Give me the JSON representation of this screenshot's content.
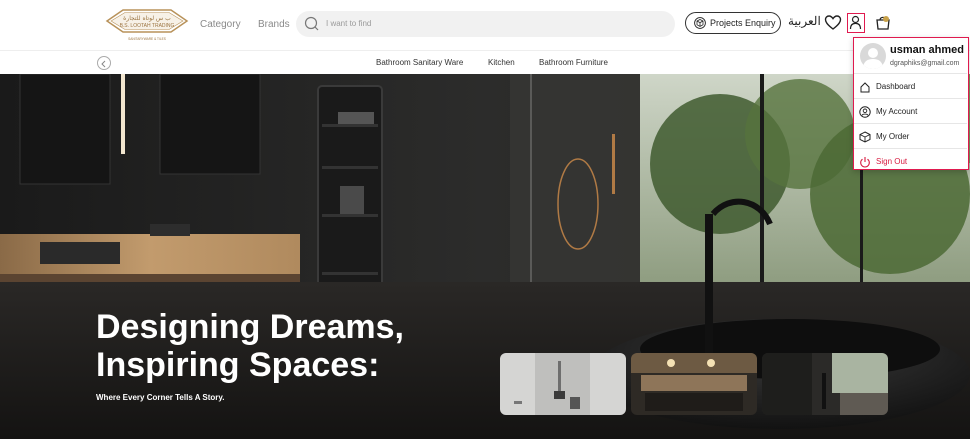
{
  "header": {
    "logo_text_arabic": "ب س لوتاه للتجارة",
    "logo_text_english": "B.S. LOOTAH TRADING",
    "logo_tagline": "SANITARYWARE & TILES",
    "nav": [
      {
        "label": "Category"
      },
      {
        "label": "Brands"
      }
    ],
    "search": {
      "placeholder": "I want to find"
    },
    "projects_enquiry": "Projects Enquiry",
    "language": "العربية"
  },
  "subnav": {
    "items": [
      {
        "label": "Bathroom Sanitary Ware"
      },
      {
        "label": "Kitchen"
      },
      {
        "label": "Bathroom Furniture"
      }
    ]
  },
  "hero": {
    "headline_line1": "Designing Dreams,",
    "headline_line2": "Inspiring Spaces:",
    "tagline": "Where Every Corner Tells A Story."
  },
  "user_menu": {
    "name": "usman ahmed",
    "email": "dgraphiks@gmail.com",
    "items": [
      {
        "label": "Dashboard",
        "icon": "home-icon"
      },
      {
        "label": "My Account",
        "icon": "account-icon"
      },
      {
        "label": "My Order",
        "icon": "box-icon"
      },
      {
        "label": "Sign Out",
        "icon": "power-icon"
      }
    ]
  },
  "colors": {
    "accent": "#e01a4f",
    "signout": "#d71a3f",
    "logo_gold": "#b8925a"
  }
}
